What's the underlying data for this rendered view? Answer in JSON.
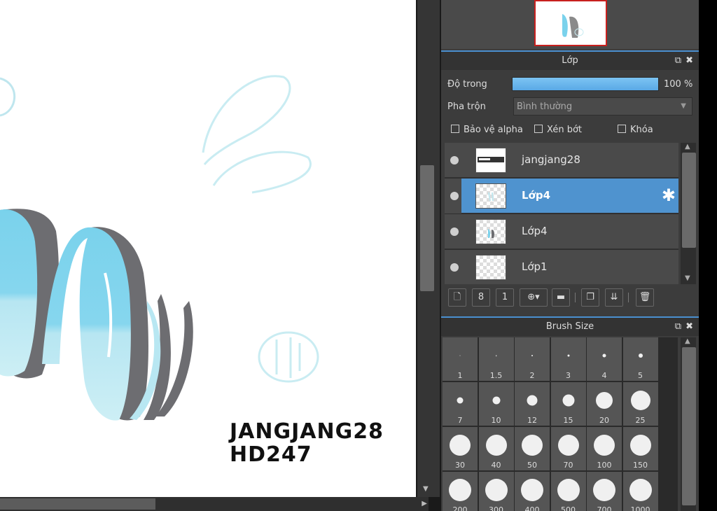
{
  "canvas": {
    "signature_line1": "JANGJANG28",
    "signature_line2": "HD247"
  },
  "layer_panel": {
    "title": "Lớp",
    "opacity_label": "Độ trong",
    "opacity_value": "100 %",
    "opacity_percent": 100,
    "blend_label": "Pha trộn",
    "blend_value": "Bình thường",
    "protect_alpha": "Bảo vệ alpha",
    "clipping": "Xén bớt",
    "lock": "Khóa",
    "layers": [
      {
        "name": "jangjang28",
        "selected": false
      },
      {
        "name": "Lớp4",
        "selected": true
      },
      {
        "name": "Lớp4",
        "selected": false
      },
      {
        "name": "Lớp1",
        "selected": false
      }
    ]
  },
  "brush_panel": {
    "title": "Brush Size",
    "sizes": [
      "1",
      "1.5",
      "2",
      "3",
      "4",
      "5",
      "7",
      "10",
      "12",
      "15",
      "20",
      "25",
      "30",
      "40",
      "50",
      "70",
      "100",
      "150",
      "200",
      "300",
      "400",
      "500",
      "700",
      "1000"
    ]
  },
  "icons": {
    "popout": "⧉",
    "close": "✖",
    "gear": "✱"
  },
  "colors": {
    "accent": "#4f93cf",
    "opacity_bar": "#6bb6ee",
    "brand_border": "#c8201e"
  }
}
